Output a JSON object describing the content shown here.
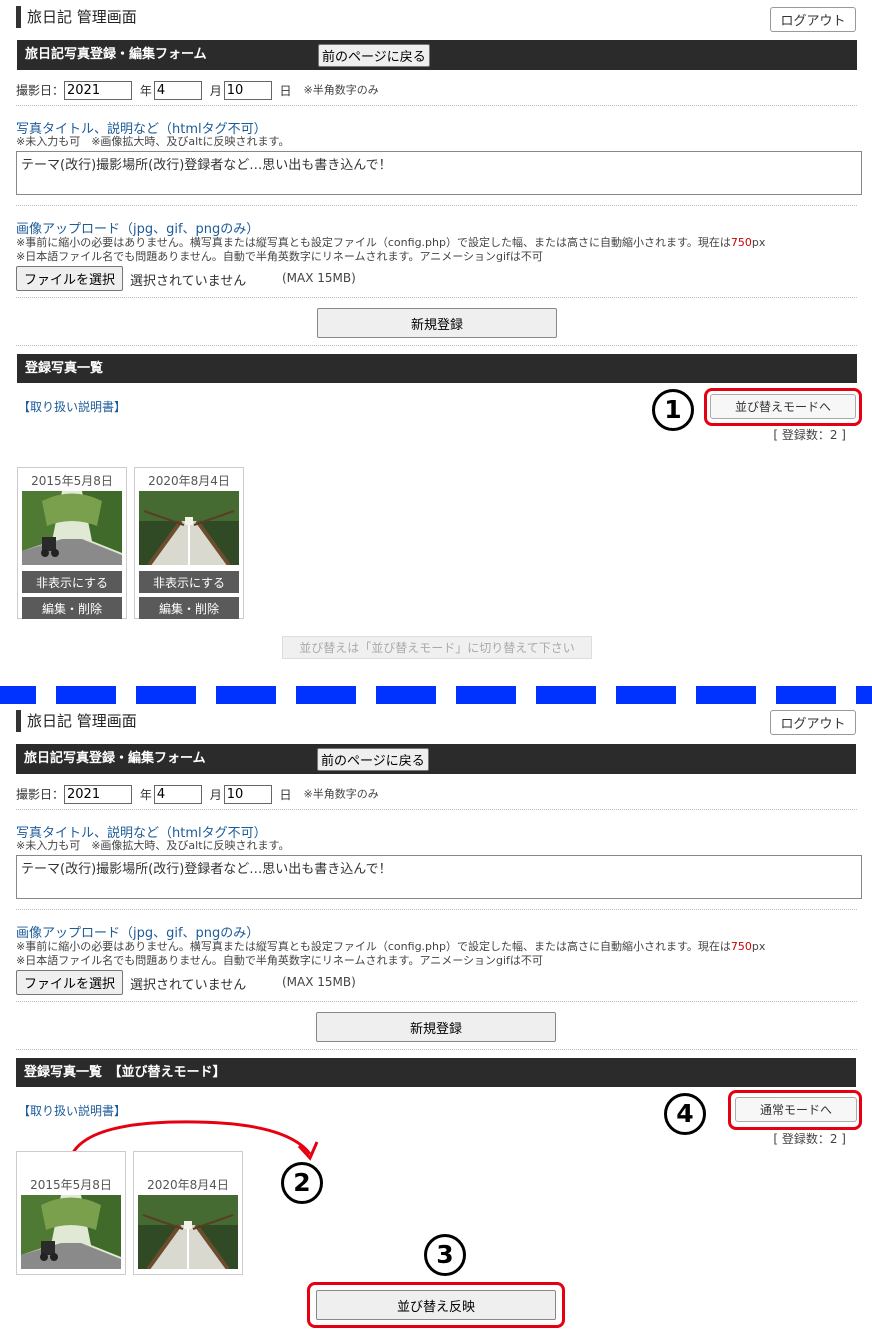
{
  "header": {
    "title": "旅日記 管理画面",
    "logout_label": "ログアウト"
  },
  "form": {
    "bar_title": "旅日記写真登録・編集フォーム",
    "back_label": "前のページに戻る",
    "date_label": "撮影日：",
    "year": "2021",
    "year_unit": "年",
    "month": "4",
    "month_unit": "月",
    "day": "10",
    "day_unit": "日",
    "date_note": "※半角数字のみ",
    "title_label": "写真タイトル、説明など（htmlタグ不可）",
    "title_note": "※未入力も可　※画像拡大時、及びaltに反映されます。",
    "title_value": "テーマ(改行)撮影場所(改行)登録者など…思い出も書き込んで！",
    "upload_label": "画像アップロード（jpg、gif、pngのみ）",
    "upload_note1_a": "※事前に縮小の必要はありません。横写真または縦写真とも設定ファイル（config.php）で設定した幅、または高さに自動縮小されます。現在は",
    "upload_note1_b": "750",
    "upload_note1_c": "px",
    "upload_note2": "※日本語ファイル名でも問題ありません。自動で半角英数字にリネームされます。アニメーションgifは不可",
    "file_button": "ファイルを選択",
    "file_status": "選択されていません",
    "max_size": "(MAX 15MB)",
    "submit_label": "新規登録"
  },
  "list1": {
    "bar_title": "登録写真一覧",
    "manual_link": "【取り扱い説明書】",
    "mode_button": "並び替えモードへ",
    "count": "[ 登録数：2 ]",
    "step": "1",
    "photos": [
      {
        "date": "2015年5月8日",
        "hide_label": "非表示にする",
        "edit_label": "編集・削除"
      },
      {
        "date": "2020年8月4日",
        "hide_label": "非表示にする",
        "edit_label": "編集・削除"
      }
    ],
    "sort_hint": "並び替えは「並び替えモード」に切り替えて下さい"
  },
  "list2": {
    "bar_title": "登録写真一覧　【並び替えモード】",
    "manual_link": "【取り扱い説明書】",
    "mode_button": "通常モードへ",
    "count": "[ 登録数：2 ]",
    "step_drag": "2",
    "step_apply": "3",
    "step_mode": "4",
    "photos": [
      {
        "date": "2015年5月8日"
      },
      {
        "date": "2020年8月4日"
      }
    ],
    "apply_label": "並び替え反映"
  },
  "colors": {
    "annotation_red": "#e60012",
    "separator_blue": "#0033ff",
    "bar_dark": "#2b2b2b",
    "link_blue": "#1c5b99"
  },
  "icons": [
    "drag-arrow-icon",
    "photo-thumbnail"
  ]
}
